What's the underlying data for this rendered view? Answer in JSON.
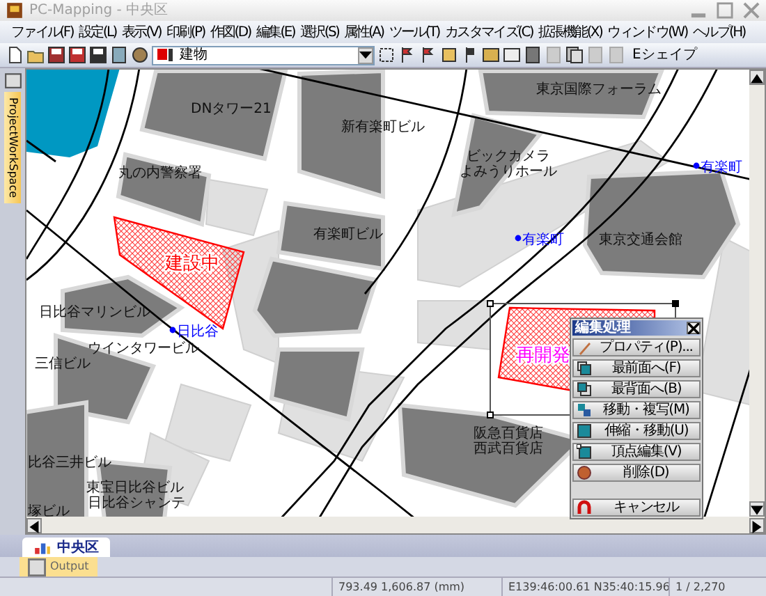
{
  "window": {
    "title": "PC-Mapping - 中央区"
  },
  "menu": [
    "ファイル(F)",
    "設定(L)",
    "表示(V)",
    "印刷(P)",
    "作図(D)",
    "編集(E)",
    "選択(S)",
    "属性(A)",
    "ツール(T)",
    "カスタマイズ(C)",
    "拡張機能(X)",
    "ウィンドウ(W)",
    "ヘルプ(H)"
  ],
  "toolbar": {
    "layer_select": "建物",
    "shape_button": "Eシェイプ"
  },
  "side_tab": "ProjectWorkSpace",
  "map": {
    "labels": [
      {
        "text": "DNタワー21",
        "kind": "building"
      },
      {
        "text": "新有楽町ビル",
        "kind": "building"
      },
      {
        "text": "東京国際フォーラム",
        "kind": "building"
      },
      {
        "text": "丸の内警察署",
        "kind": "building"
      },
      {
        "text": "ビックカメラ",
        "kind": "building"
      },
      {
        "text": "よみうりホール",
        "kind": "building"
      },
      {
        "text": "有楽町",
        "kind": "station"
      },
      {
        "text": "有楽町ビル",
        "kind": "building"
      },
      {
        "text": "有楽町",
        "kind": "station"
      },
      {
        "text": "東京交通会館",
        "kind": "building"
      },
      {
        "text": "建設中",
        "kind": "site",
        "color": "#ff0000"
      },
      {
        "text": "日比谷マリンビル",
        "kind": "building"
      },
      {
        "text": "日比谷",
        "kind": "station"
      },
      {
        "text": "ウインタワービル",
        "kind": "building"
      },
      {
        "text": "三信ビル",
        "kind": "building"
      },
      {
        "text": "再開発",
        "kind": "site",
        "color": "#ff00ff"
      },
      {
        "text": "阪急百貨店",
        "kind": "building"
      },
      {
        "text": "西武百貨店",
        "kind": "building"
      },
      {
        "text": "比谷三井ビル",
        "kind": "building"
      },
      {
        "text": "東宝日比谷ビル",
        "kind": "building"
      },
      {
        "text": "日比谷シャンテ",
        "kind": "building"
      },
      {
        "text": "塚ビル",
        "kind": "building"
      }
    ]
  },
  "edit_panel": {
    "title": "編集処理",
    "buttons": [
      {
        "label": "プロパティ(P)...",
        "kind": "property"
      },
      {
        "label": "最前面へ(F)",
        "kind": "front"
      },
      {
        "label": "最背面へ(B)",
        "kind": "back"
      },
      {
        "label": "移動・複写(M)",
        "kind": "move"
      },
      {
        "label": "伸縮・移動(U)",
        "kind": "scale"
      },
      {
        "label": "頂点編集(V)",
        "kind": "vertex"
      },
      {
        "label": "削除(D)",
        "kind": "delete"
      },
      {
        "label": "キャンセル",
        "kind": "cancel"
      }
    ]
  },
  "doc_tabs": [
    {
      "label": "中央区",
      "selected": true
    }
  ],
  "output_tab": "Output",
  "status_bar": [
    "793.49 1,606.87 (mm)",
    "E139:46:00.61 N35:40:15.96",
    "1 / 2,270"
  ]
}
